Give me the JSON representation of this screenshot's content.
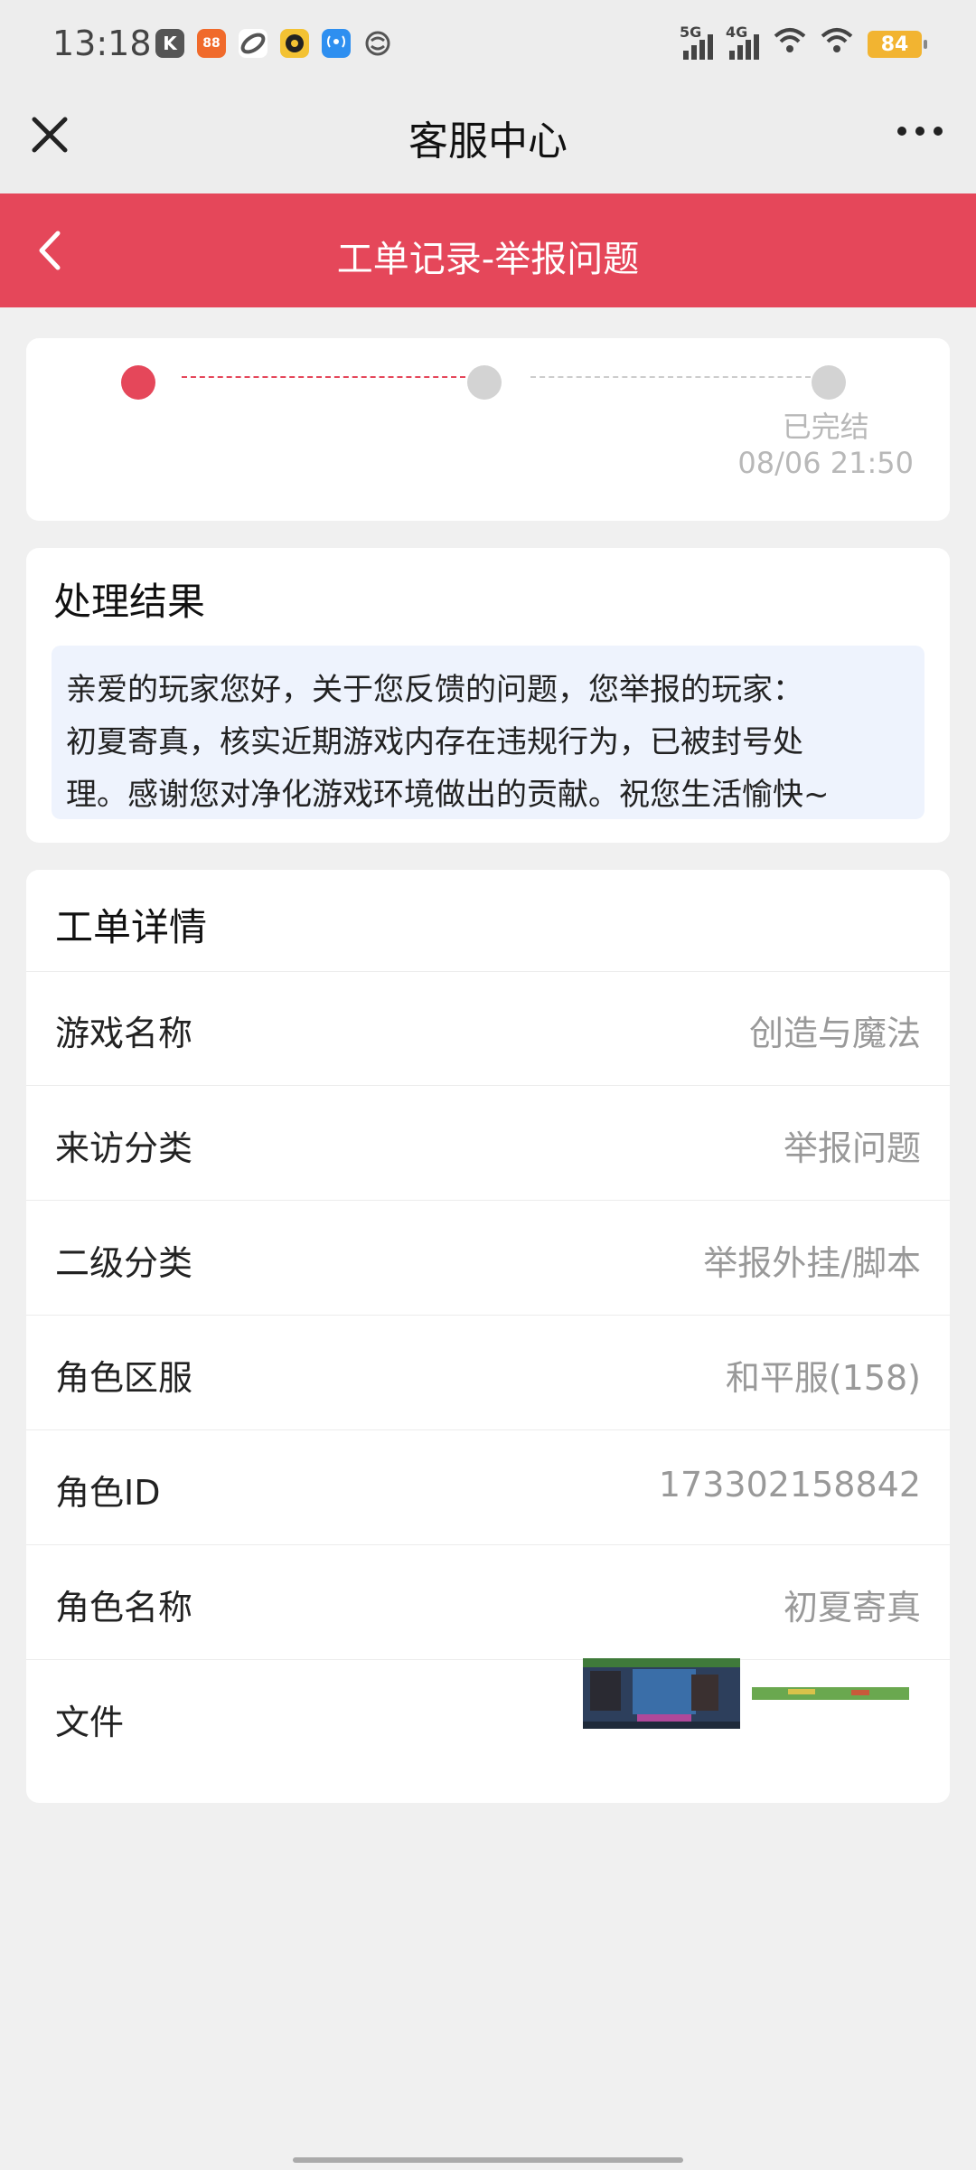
{
  "status_bar": {
    "time": "13:18",
    "app_icons": [
      "K",
      "88",
      "game-icon",
      "music-icon",
      "app-icon",
      "mobile-icon"
    ],
    "signal1": "5G",
    "signal2": "4G",
    "battery": "84"
  },
  "nav": {
    "title": "客服中心"
  },
  "header": {
    "title": "工单记录-举报问题"
  },
  "progress": {
    "final_status": "已完结",
    "final_time": "08/06 21:50"
  },
  "result": {
    "heading": "处理结果",
    "lines": [
      "亲爱的玩家您好，关于您反馈的问题，您举报的玩家：",
      "初夏寄真，核实近期游戏内存在违规行为，已被封号处",
      "理。感谢您对净化游戏环境做出的贡献。祝您生活愉快~"
    ]
  },
  "details": {
    "heading": "工单详情",
    "rows": [
      {
        "label": "游戏名称",
        "value": "创造与魔法"
      },
      {
        "label": "来访分类",
        "value": "举报问题"
      },
      {
        "label": "二级分类",
        "value": "举报外挂/脚本"
      },
      {
        "label": "角色区服",
        "value": "和平服(158)"
      },
      {
        "label": "角色ID",
        "value": "173302158842"
      },
      {
        "label": "角色名称",
        "value": "初夏寄真"
      }
    ],
    "files_label": "文件"
  },
  "colors": {
    "accent": "#e5475a",
    "result_bg": "#eef3fd"
  }
}
